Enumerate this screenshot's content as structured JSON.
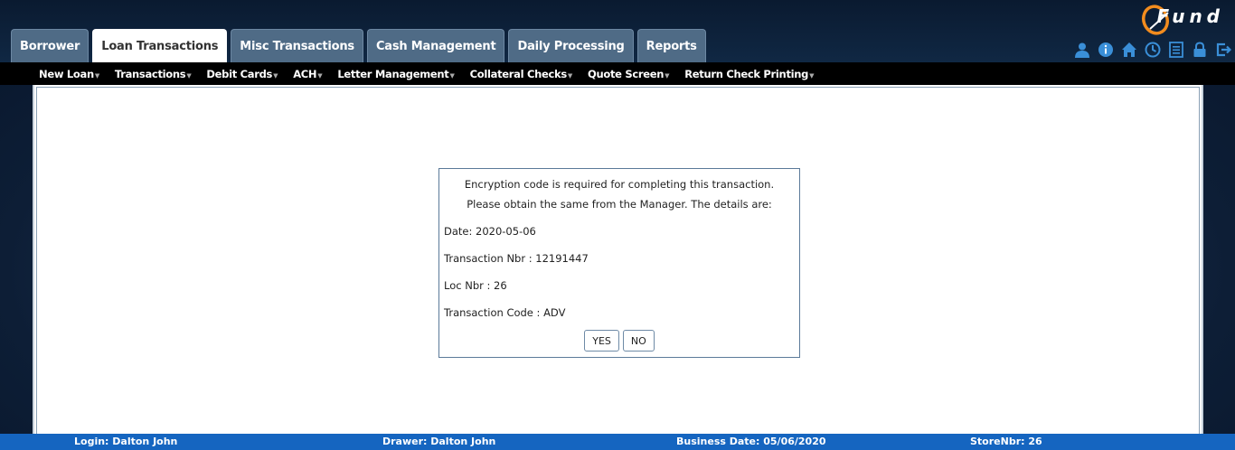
{
  "brand": {
    "logo_text": "Fund"
  },
  "tabs": [
    {
      "label": "Borrower",
      "active": false
    },
    {
      "label": "Loan Transactions",
      "active": true
    },
    {
      "label": "Misc Transactions",
      "active": false
    },
    {
      "label": "Cash Management",
      "active": false
    },
    {
      "label": "Daily Processing",
      "active": false
    },
    {
      "label": "Reports",
      "active": false
    }
  ],
  "header_icons": [
    "user-icon",
    "info-icon",
    "home-icon",
    "clock-icon",
    "list-icon",
    "lock-icon",
    "logout-icon"
  ],
  "subnav": [
    {
      "label": "New Loan",
      "has_caret": true
    },
    {
      "label": "Transactions",
      "has_caret": true
    },
    {
      "label": "Debit Cards",
      "has_caret": true
    },
    {
      "label": "ACH",
      "has_caret": true
    },
    {
      "label": "Letter Management",
      "has_caret": true
    },
    {
      "label": "Collateral Checks",
      "has_caret": true
    },
    {
      "label": "Quote Screen",
      "has_caret": true
    },
    {
      "label": "Return Check Printing",
      "has_caret": true
    }
  ],
  "dialog": {
    "line1": "Encryption code is required for completing this transaction.",
    "line2": "Please obtain the same from the Manager. The details are:",
    "date": "Date: 2020-05-06",
    "transaction_nbr": "Transaction Nbr : 12191447",
    "loc_nbr": "Loc Nbr : 26",
    "transaction_code": "Transaction Code : ADV",
    "yes_label": "YES",
    "no_label": "NO"
  },
  "footer": {
    "login": "Login: Dalton John",
    "drawer": "Drawer: Dalton John",
    "business_date": "Business Date: 05/06/2020",
    "store_nbr": "StoreNbr: 26"
  },
  "colors": {
    "tab_bg": "#4f6b86",
    "accent": "#1565c0",
    "icon": "#3a8fd8",
    "logo_orange": "#f28c1e"
  }
}
